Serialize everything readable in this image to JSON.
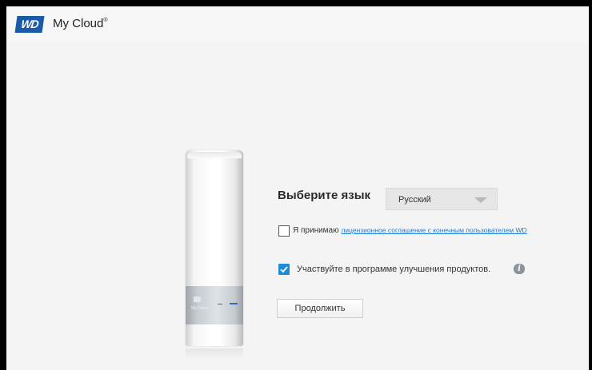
{
  "header": {
    "logo_text": "WD",
    "app_title": "My Cloud",
    "app_title_mark": "®"
  },
  "device": {
    "brand_text": "My Cloud"
  },
  "language": {
    "label": "Выберите язык",
    "selected": "Русский"
  },
  "eula": {
    "checked": false,
    "prefix": "Я принимаю",
    "link_text": "лицензионное соглашение с конечным пользователем WD"
  },
  "improvement": {
    "checked": true,
    "label": "Участвуйте в программе улучшения продуктов."
  },
  "info_icon_glyph": "i",
  "continue_label": "Продолжить",
  "colors": {
    "brand_blue": "#1a5aa6",
    "link": "#1f7ad4",
    "checkbox_checked": "#1f8ad6"
  }
}
